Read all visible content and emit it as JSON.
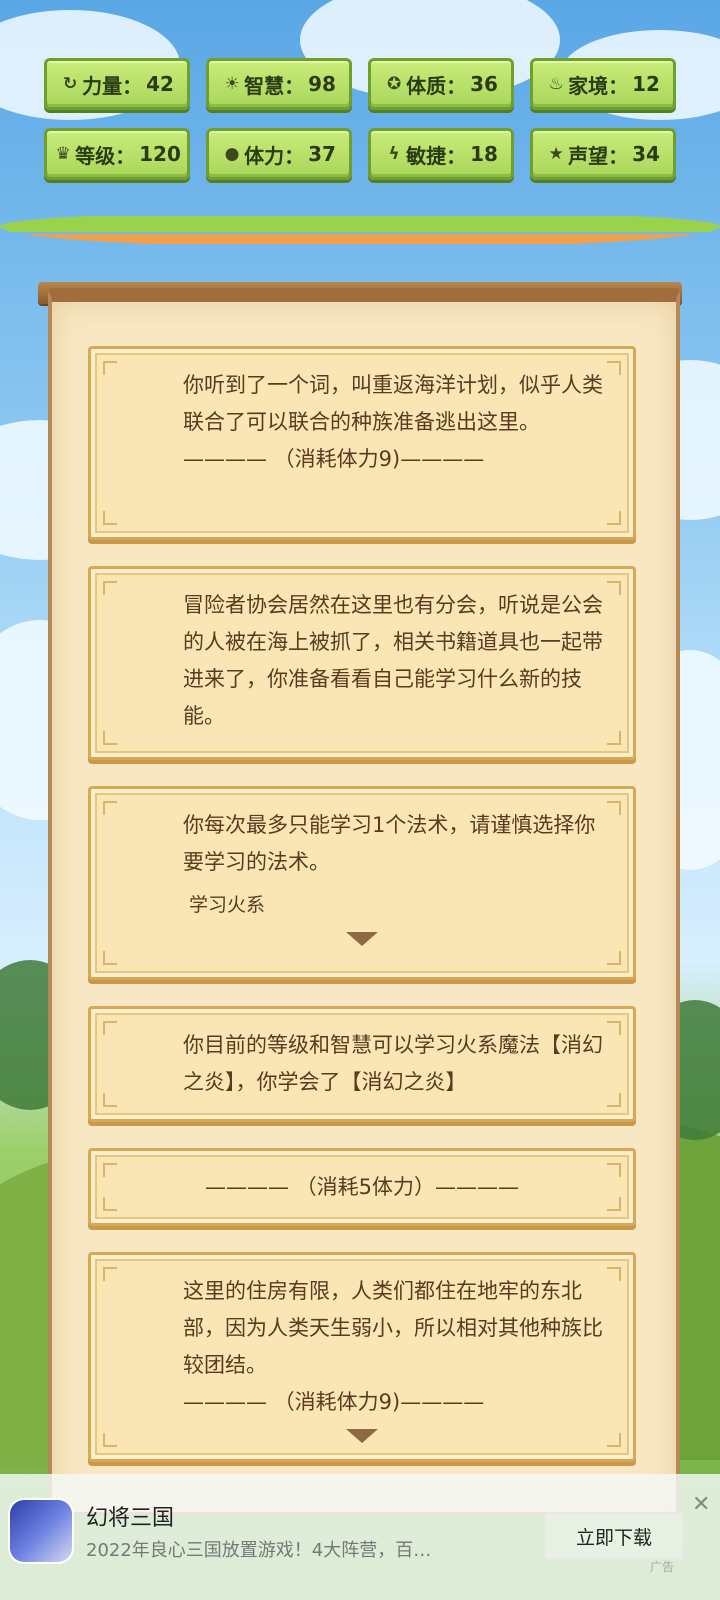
{
  "stats": {
    "row1": [
      {
        "icon": "strength-icon",
        "glyph": "↻",
        "label": "力量：",
        "value": "42"
      },
      {
        "icon": "wisdom-icon",
        "glyph": "☀",
        "label": "智慧：",
        "value": "98"
      },
      {
        "icon": "constitution-icon",
        "glyph": "✪",
        "label": "体质：",
        "value": "36"
      },
      {
        "icon": "family-icon",
        "glyph": "♨",
        "label": "家境：",
        "value": "12"
      }
    ],
    "row2": [
      {
        "icon": "crown-icon",
        "glyph": "♛",
        "label": "等级：",
        "value": "120"
      },
      {
        "icon": "heart-icon",
        "glyph": "●",
        "label": "体力：",
        "value": "37"
      },
      {
        "icon": "lightning-icon",
        "glyph": "ϟ",
        "label": "敏捷：",
        "value": "18"
      },
      {
        "icon": "star-icon",
        "glyph": "★",
        "label": "声望：",
        "value": "34"
      }
    ]
  },
  "cards": {
    "c1": {
      "text": "你听到了一个词，叫重返海洋计划，似乎人类联合了可以联合的种族准备逃出这里。",
      "divider": "———— （消耗体力9)————"
    },
    "c2": {
      "text": "冒险者协会居然在这里也有分会，听说是公会的人被在海上被抓了，相关书籍道具也一起带进来了，你准备看看自己能学习什么新的技能。"
    },
    "c3": {
      "text": "你每次最多只能学习1个法术，请谨慎选择你要学习的法术。",
      "sub": "学习火系"
    },
    "c4": {
      "text": "你目前的等级和智慧可以学习火系魔法【消幻之炎】，你学会了【消幻之炎】"
    },
    "c5": {
      "divider": "———— （消耗5体力）————"
    },
    "c6": {
      "text": "这里的住房有限，人类们都住在地牢的东北部，因为人类天生弱小，所以相对其他种族比较团结。",
      "divider": "———— （消耗体力9)————"
    }
  },
  "ad": {
    "title": "幻将三国",
    "desc": "2022年良心三国放置游戏！4大阵营，百…",
    "button": "立即下载",
    "close": "✕",
    "tag": "广告"
  }
}
